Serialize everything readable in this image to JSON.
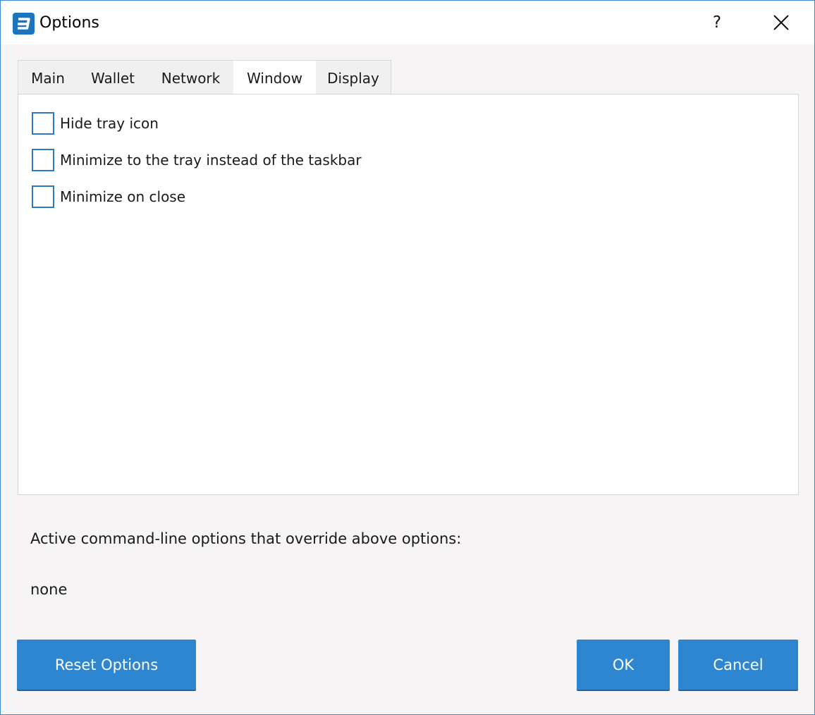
{
  "window": {
    "title": "Options",
    "help_label": "?",
    "accent_color": "#2f86d0",
    "icons": {
      "app": "dash-logo-icon",
      "close": "close-icon"
    }
  },
  "tabs": [
    {
      "label": "Main",
      "active": false
    },
    {
      "label": "Wallet",
      "active": false
    },
    {
      "label": "Network",
      "active": false
    },
    {
      "label": "Window",
      "active": true
    },
    {
      "label": "Display",
      "active": false
    }
  ],
  "window_tab": {
    "options": [
      {
        "label": "Hide tray icon",
        "checked": false
      },
      {
        "label": "Minimize to the tray instead of the taskbar",
        "checked": false
      },
      {
        "label": "Minimize on close",
        "checked": false
      }
    ]
  },
  "command_line": {
    "label": "Active command-line options that override above options:",
    "value": "none"
  },
  "buttons": {
    "reset": "Reset Options",
    "ok": "OK",
    "cancel": "Cancel"
  }
}
